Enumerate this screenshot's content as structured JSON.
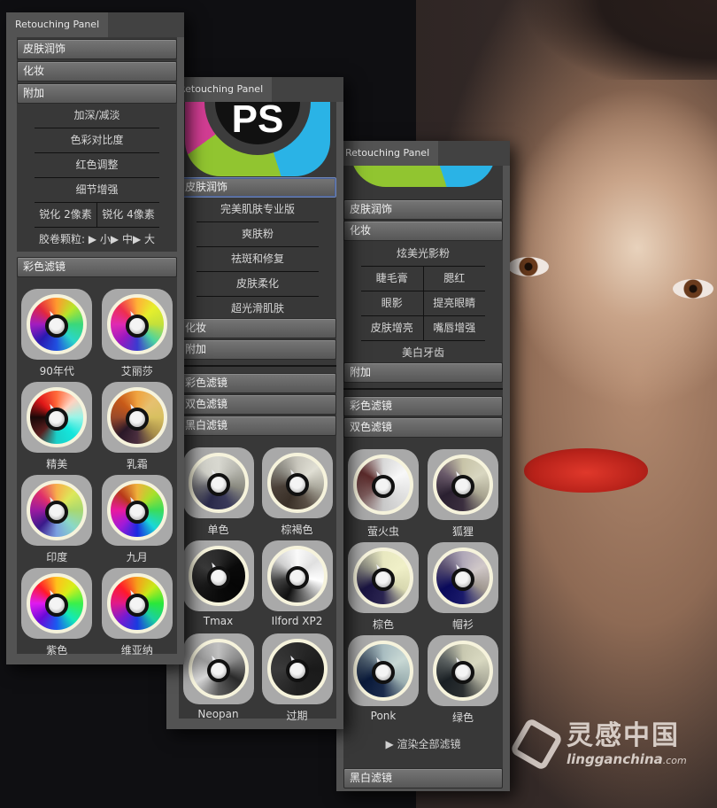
{
  "panel_tab_title": "Retouching Panel",
  "panel1": {
    "sections": [
      "皮肤润饰",
      "化妆",
      "附加"
    ],
    "addons": {
      "items": [
        "加深/减淡",
        "色彩对比度",
        "红色调整",
        "细节增强"
      ],
      "sharpen": [
        "锐化 2像素",
        "锐化 4像素"
      ],
      "grain": "胶卷颗粒: ▶ 小▶ 中▶ 大"
    },
    "filter_section": "彩色滤镜",
    "filters": [
      {
        "label": "90年代",
        "colors": "conic-gradient(#ff9a2e,#b8e62a,#3ad87a,#2ad6c8,#2050e0,#2a1ab0,#a21cc0,#e2283e,#ff9a2e)"
      },
      {
        "label": "艾丽莎",
        "colors": "conic-gradient(#ffb236,#e6ef2c,#c4e03a,#4bd3a0,#3b3ad0,#9a18c0,#e02ab2,#ee2e4e,#ffb236)"
      },
      {
        "label": "精美",
        "colors": "conic-gradient(#ff6a3a,#ffd2c0,#9af5e8,#14e6dc,#1ad0c8,#5a1f1f,#1a0808,#e01818,#ff6a3a)"
      },
      {
        "label": "乳霜",
        "colors": "conic-gradient(#f0a440,#e6c070,#d8c060,#a88e4a,#4a2e3e,#2a1828,#9a4a2a,#c85a18,#f0a440)"
      },
      {
        "label": "印度",
        "colors": "conic-gradient(#f8b04a,#dce85a,#a8d870,#8ad8c8,#7aa0e0,#3a1a8a,#9a1aa0,#e0306a,#f8b04a)"
      },
      {
        "label": "九月",
        "colors": "conic-gradient(#f0b23a,#a8e02a,#3adc5a,#18d8d8,#1a2ae0,#a01ad8,#e81aa0,#b83a1a,#f0b23a)"
      },
      {
        "label": "紫色",
        "colors": "conic-gradient(#ffc21a,#d6f01a,#3af04a,#12e8b8,#1a5af0,#6a0ad8,#e01af0,#ff1a2a,#ffc21a)"
      },
      {
        "label": "维亚纳",
        "colors": "conic-gradient(#f6a01a,#c8ea1a,#2ae83a,#1ad0a0,#1a3ae0,#7a1ad0,#e01a8a,#ff1a2a,#f6a01a)"
      }
    ]
  },
  "panel2": {
    "skin_section": "皮肤润饰",
    "skin_items": [
      "完美肌肤专业版",
      "爽肤粉",
      "祛斑和修复",
      "皮肤柔化",
      "超光滑肌肤"
    ],
    "sections_after": [
      "化妆",
      "附加"
    ],
    "filter_sections": [
      "彩色滤镜",
      "双色滤镜",
      "黑白滤镜"
    ],
    "filters": [
      {
        "label": "单色",
        "colors": "conic-gradient(#d8d8d0,#b8b8b0,#8a8a80,#3a3a5a,#2a2a4a,#6a6a70,#d0d0c8,#d8d8d0)"
      },
      {
        "label": "棕褐色",
        "colors": "conic-gradient(#c8c6bc,#e0dfd4,#aaa89c,#5a5046,#3a3028,#4a4038,#8a8880,#c8c6bc)"
      },
      {
        "label": "Tmax",
        "colors": "conic-gradient(#2a2a2a,#0a0a0a,#050505,#0a0a0a,#1a1a1a,#3a3a3a,#2a2a2a)"
      },
      {
        "label": "Ilford XP2",
        "colors": "conic-gradient(#fafafa,#e0e0e0,#ffffff,#808080,#101010,#404040,#d0d0d0,#fafafa)"
      },
      {
        "label": "Neopan",
        "colors": "conic-gradient(#c0c0c0,#8a8a8a,#2a2a2a,#5a5a5a,#d8d8d8,#9a9a9a,#c0c0c0)"
      },
      {
        "label": "过期",
        "colors": "conic-gradient(#2a2a2a,#1a1a1a,#202020,#3a3a3a,#2a2a2a)"
      }
    ]
  },
  "panel3": {
    "sections_top": [
      "皮肤润饰",
      "化妆"
    ],
    "makeup_first": "炫美光影粉",
    "makeup_pairs": [
      [
        "睫毛膏",
        "腮红"
      ],
      [
        "眼影",
        "提亮眼睛"
      ],
      [
        "皮肤增亮",
        "嘴唇增强"
      ]
    ],
    "makeup_last": "美白牙齿",
    "section_addon": "附加",
    "filter_sections": [
      "彩色滤镜",
      "双色滤镜"
    ],
    "filters": [
      {
        "label": "萤火虫",
        "colors": "conic-gradient(#d8d8d8,#f8f8f8,#e0e0e0,#c8c8c8,#7a5a5a,#5a2a2a,#d8d8d8)"
      },
      {
        "label": "狐狸",
        "colors": "conic-gradient(#c8c4a8,#d8d6c0,#a8a490,#3a2e3e,#2a2030,#6a5a6a,#c8c4a8)"
      },
      {
        "label": "棕色",
        "colors": "conic-gradient(#e8e8c0,#f0f0c8,#d8d8b0,#2a2450,#1a1440,#8a8a80,#e8e8c0)"
      },
      {
        "label": "帽衫",
        "colors": "conic-gradient(#b0a8b8,#d0c8c8,#a09890,#1a1a6a,#0a0a5a,#5a5070,#b0a8b8)"
      },
      {
        "label": "Ponk",
        "colors": "conic-gradient(#a8bcc0,#c8d8d4,#9aaeb0,#1a2a4a,#0a1a3a,#4a5a6a,#a8bcc0)"
      },
      {
        "label": "绿色",
        "colors": "conic-gradient(#c8c8b0,#d8d8c0,#a8a898,#2a2e30,#1a2024,#5a6060,#c8c8b0)"
      }
    ],
    "render_all": "▶ 渲染全部滤镜",
    "bw_section": "黑白滤镜"
  },
  "watermark": {
    "cn": "灵感中国",
    "en": "lingganchina",
    "tld": ".com"
  }
}
